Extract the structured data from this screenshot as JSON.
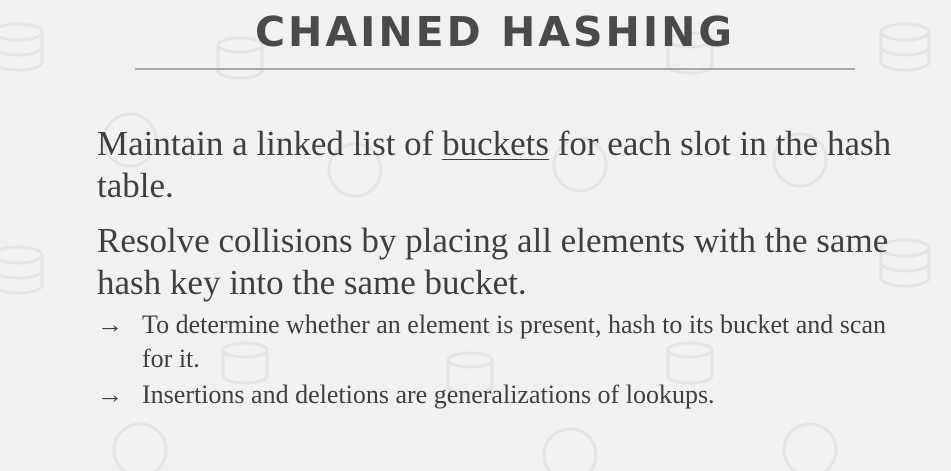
{
  "slide": {
    "title": "CHAINED HASHING",
    "paragraphs": [
      {
        "before": "Maintain a linked list of ",
        "underlined": "buckets",
        "after": " for each slot in the hash table."
      },
      {
        "text": "Resolve collisions by placing all elements with the same hash key into the same bucket."
      }
    ],
    "bullets": [
      {
        "arrow": "→",
        "text": "To determine whether an element is present, hash to its bucket and scan for it."
      },
      {
        "arrow": "→",
        "text": "Insertions and deletions are generalizations of lookups."
      }
    ]
  }
}
